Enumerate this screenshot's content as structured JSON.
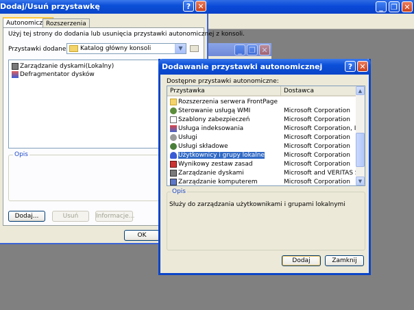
{
  "console_window": {
    "buttons": [
      "minimize",
      "restore",
      "close"
    ]
  },
  "addremove_dialog": {
    "title": "Dodaj/Usuń przystawkę",
    "help_glyph": "?",
    "close_glyph": "✕",
    "tabs": [
      "Autonomiczna",
      "Rozszerzenia"
    ],
    "instruction": "Użyj tej strony do dodania lub usunięcia przystawki autonomicznej z konsoli.",
    "added_to_label": "Przystawki dodane do:",
    "added_to_value": "Katalog główny konsoli",
    "snapins": [
      {
        "label": "Zarządzanie dyskami(Lokalny)",
        "icon": "disk-management-icon"
      },
      {
        "label": "Defragmentator dysków",
        "icon": "defragmenter-icon"
      }
    ],
    "description_group": "Opis",
    "buttons": {
      "add": "Dodaj...",
      "remove": "Usuń",
      "about": "Informacje...",
      "ok": "OK"
    }
  },
  "add_snapin_dialog": {
    "title": "Dodawanie przystawki autonomicznej",
    "help_glyph": "?",
    "close_glyph": "✕",
    "available_label": "Dostępne przystawki autonomiczne:",
    "columns": [
      "Przystawka",
      "Dostawca"
    ],
    "rows": [
      {
        "name": "Rozszerzenia serwera FrontPage",
        "vendor": "",
        "icon": "folder-icon"
      },
      {
        "name": "Sterowanie usługą WMI",
        "vendor": "Microsoft Corporation",
        "icon": "wmi-icon"
      },
      {
        "name": "Szablony zabezpieczeń",
        "vendor": "Microsoft Corporation",
        "icon": "security-templates-icon"
      },
      {
        "name": "Usługa indeksowania",
        "vendor": "Microsoft Corporation, Inc...",
        "icon": "indexing-icon"
      },
      {
        "name": "Usługi",
        "vendor": "Microsoft Corporation",
        "icon": "services-icon"
      },
      {
        "name": "Usługi składowe",
        "vendor": "Microsoft Corporation",
        "icon": "component-services-icon"
      },
      {
        "name": "Użytkownicy i grupy lokalne",
        "vendor": "Microsoft Corporation",
        "icon": "users-groups-icon",
        "selected": true
      },
      {
        "name": "Wynikowy zestaw zasad",
        "vendor": "Microsoft Corporation",
        "icon": "rsop-icon"
      },
      {
        "name": "Zarządzanie dyskami",
        "vendor": "Microsoft and VERITAS S...",
        "icon": "disk-management-icon"
      },
      {
        "name": "Zarządzanie komputerem",
        "vendor": "Microsoft Corporation",
        "icon": "computer-management-icon"
      }
    ],
    "description_group": "Opis",
    "description": "Służy do zarządzania użytkownikami i grupami lokalnymi",
    "buttons": {
      "add": "Dodaj",
      "close": "Zamknij"
    }
  },
  "colors": {
    "xp_blue": "#0a4ad8",
    "selection": "#316ac5",
    "group_label": "#1e48c8"
  }
}
